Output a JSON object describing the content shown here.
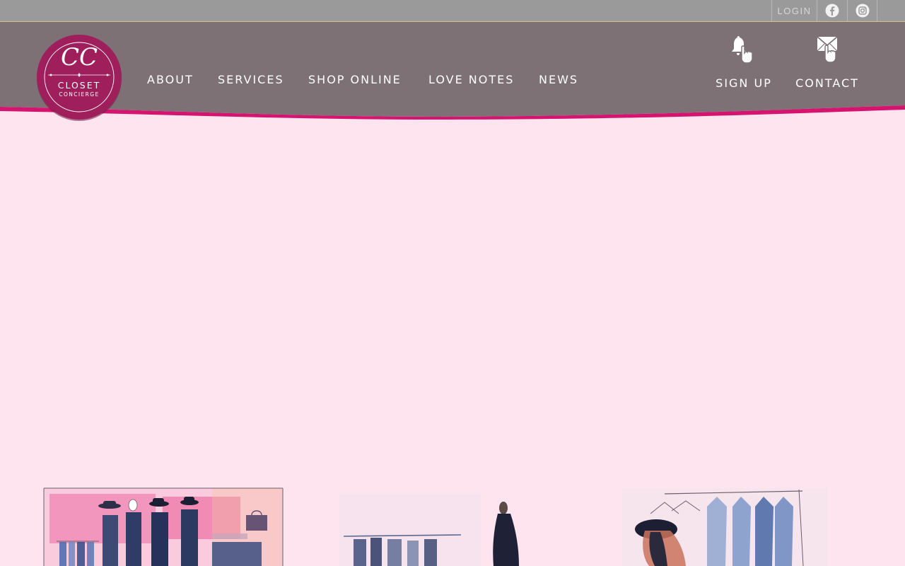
{
  "topbar": {
    "login_label": "LOGIN",
    "facebook_icon": "facebook-icon",
    "instagram_icon": "instagram-icon"
  },
  "brand": {
    "logo_monogram": "CC",
    "logo_line1": "CLOSET",
    "logo_line2": "CONCIERGE"
  },
  "nav": {
    "items": [
      {
        "label": "ABOUT"
      },
      {
        "label": "SERVICES"
      },
      {
        "label": "SHOP ONLINE"
      },
      {
        "label": "LOVE NOTES"
      },
      {
        "label": "NEWS"
      }
    ]
  },
  "actions": {
    "signup_label": "SIGN UP",
    "signup_icon": "bell-pointer-icon",
    "contact_label": "CONTACT",
    "contact_icon": "envelope-pointer-icon"
  },
  "colors": {
    "page_background": "#fde4ee",
    "topbar": "#9a9a9a",
    "header": "#7d7176",
    "accent_pink": "#d5146f",
    "logo": "#9e1f5b"
  }
}
